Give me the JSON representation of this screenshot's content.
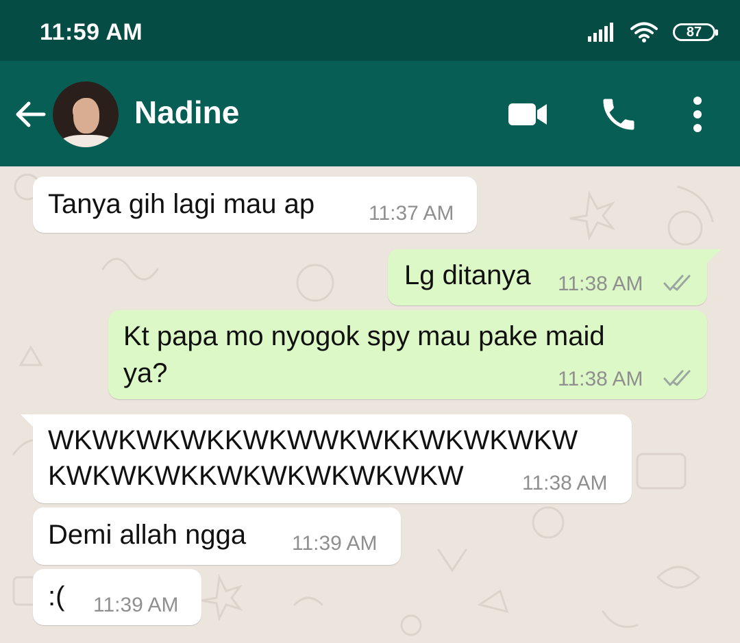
{
  "status_bar": {
    "time": "11:59 AM",
    "battery": "87"
  },
  "header": {
    "contact_name": "Nadine"
  },
  "messages": [
    {
      "direction": "in",
      "text": "Tanya gih lagi mau ap",
      "time": "11:37 AM"
    },
    {
      "direction": "out",
      "text": "Lg ditanya",
      "time": "11:38 AM",
      "status": "read"
    },
    {
      "direction": "out",
      "lines": [
        "Kt papa mo nyogok spy mau pake maid",
        "ya?"
      ],
      "time": "11:38 AM",
      "status": "read"
    },
    {
      "direction": "in",
      "lines": [
        "WKWKWKWKKWKWWKWKKWKWKWKW",
        "KWKWKWKKWKWKWKWKWKW"
      ],
      "time": "11:38 AM"
    },
    {
      "direction": "in",
      "text": "Demi allah ngga",
      "time": "11:39 AM"
    },
    {
      "direction": "in",
      "text": ":(",
      "time": "11:39 AM"
    }
  ],
  "colors": {
    "status_bar": "#054d44",
    "app_bar": "#075e54",
    "incoming_bubble": "#ffffff",
    "outgoing_bubble": "#dcf8c6",
    "chat_background": "#ece5dd",
    "read_ticks": "#9aa7a0"
  },
  "icons": [
    "back-arrow-icon",
    "video-call-icon",
    "voice-call-icon",
    "more-options-icon",
    "signal-icon",
    "wifi-icon",
    "battery-icon",
    "double-check-icon"
  ]
}
